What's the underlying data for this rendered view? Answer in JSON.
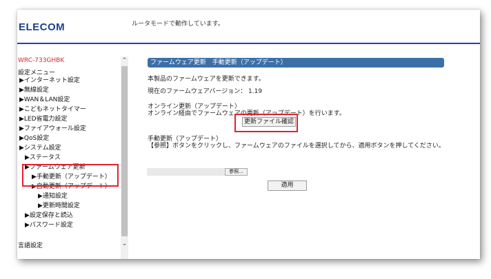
{
  "header": {
    "logo": "ELECOM",
    "status": "ルータモードで動作しています。"
  },
  "sidebar": {
    "model": "WRC-733GHBK",
    "menu_title": "設定メニュー",
    "items": [
      "▶インターネット設定",
      "▶無線設定",
      "▶WAN＆LAN設定",
      "▶こどもネットタイマー",
      "▶LED省電力設定",
      "▶ファイアウォール設定",
      "▶QoS設定",
      "▶システム設定",
      "▶ステータス",
      "▶ファームウェア更新",
      "▶手動更新（アップデート）",
      "▶自動更新（アップデート）",
      "▶通知設定",
      "▶更新時間設定",
      "▶設定保存と読込",
      "▶パスワード設定"
    ],
    "language": "言語設定"
  },
  "scrollbar": {
    "up": "⌃",
    "down": "⌄"
  },
  "main": {
    "title": "ファームウェア更新　手動更新（アップデート）",
    "intro": "本製品のファームウェアを更新できます。",
    "current_version": "現在のファームウェアバージョン： 1.19",
    "online_heading": "オンライン更新（アップデート）",
    "online_desc": "オンライン経由でファームウェアの更新（アップデート）を行います。",
    "check_button": "更新ファイル確認",
    "manual_heading": "手動更新（アップデート）",
    "manual_desc": "【参照】ボタンをクリックし、ファームウェアのファイルを選択してから、適用ボタンを押してください。",
    "browse_button": "参照...",
    "apply_button": "適用"
  },
  "colors": {
    "accent": "#1e3cc8",
    "title_bar": "#3c6fa8",
    "highlight": "#e2202b",
    "model": "#d8262e"
  }
}
